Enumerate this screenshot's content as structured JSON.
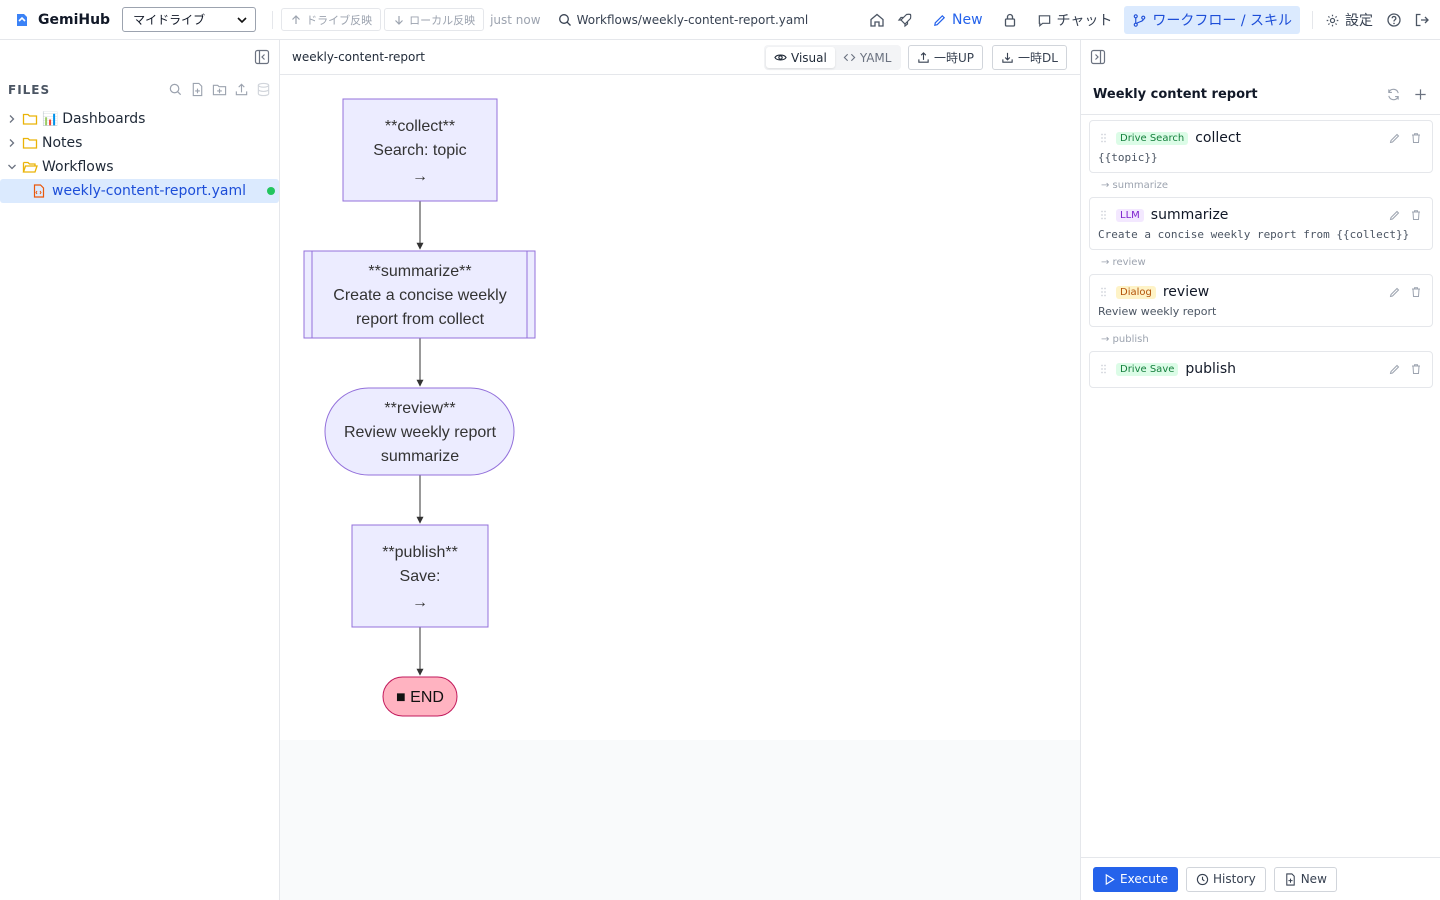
{
  "app": {
    "name": "GemiHub"
  },
  "topbar": {
    "drive_select": "マイドライブ",
    "sync_up_label": "ドライブ反映",
    "sync_down_label": "ローカル反映",
    "sync_time": "just now",
    "file_path": "Workflows/weekly-content-report.yaml",
    "new_label": "New",
    "chat_label": "チャット",
    "workflow_label": "ワークフロー / スキル",
    "settings_label": "設定",
    "accent_color": "#2563eb"
  },
  "sidebar": {
    "title": "FILES",
    "items": [
      {
        "label": "Dashboards",
        "emoji": "📊",
        "type": "folder",
        "expanded": false
      },
      {
        "label": "Notes",
        "type": "folder",
        "expanded": false
      },
      {
        "label": "Workflows",
        "type": "folder",
        "expanded": true
      },
      {
        "label": "weekly-content-report.yaml",
        "type": "file",
        "selected": true,
        "status": "synced"
      }
    ]
  },
  "editor": {
    "title": "weekly-content-report",
    "mode_visual": "Visual",
    "mode_yaml": "YAML",
    "temp_upload": "一時UP",
    "temp_download": "一時DL",
    "active_mode": "Visual"
  },
  "flowchart": {
    "nodes": [
      {
        "id": "collect",
        "shape": "rect",
        "lines": [
          "**collect**",
          "Search: topic",
          "→"
        ]
      },
      {
        "id": "summarize",
        "shape": "subroutine",
        "lines": [
          "**summarize**",
          "Create a concise weekly",
          "report from collect"
        ]
      },
      {
        "id": "review",
        "shape": "stadium",
        "lines": [
          "**review**",
          "Review weekly report",
          "summarize"
        ]
      },
      {
        "id": "publish",
        "shape": "rect",
        "lines": [
          "**publish**",
          "Save:",
          "→"
        ]
      },
      {
        "id": "end",
        "shape": "terminal",
        "lines": [
          "■ END"
        ]
      }
    ],
    "colors": {
      "node_fill": "#ececff",
      "node_stroke": "#9370db",
      "end_fill": "#ffb3c1",
      "end_stroke": "#c2185b"
    }
  },
  "panel": {
    "title": "Weekly content report",
    "nodes": [
      {
        "badge": "Drive Search",
        "badge_color": "green",
        "name": "collect",
        "desc": "{{topic}}",
        "next": "→ summarize"
      },
      {
        "badge": "LLM",
        "badge_color": "purple",
        "name": "summarize",
        "desc": "Create a concise weekly report from {{collect}}",
        "next": "→ review"
      },
      {
        "badge": "Dialog",
        "badge_color": "amber",
        "name": "review",
        "desc": "Review weekly report",
        "next": "→ publish"
      },
      {
        "badge": "Drive Save",
        "badge_color": "green",
        "name": "publish",
        "desc": "",
        "next": ""
      }
    ],
    "execute_label": "Execute",
    "history_label": "History",
    "new_label": "New"
  }
}
